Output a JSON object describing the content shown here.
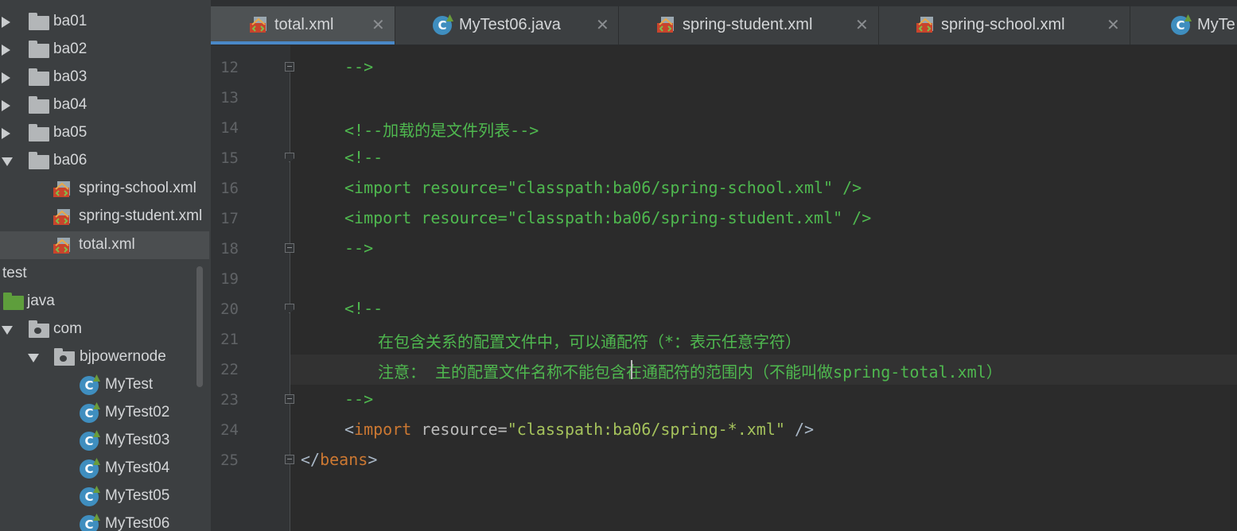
{
  "project_tree": {
    "items": [
      {
        "label": "ba01",
        "type": "folder",
        "expanded": false
      },
      {
        "label": "ba02",
        "type": "folder",
        "expanded": false
      },
      {
        "label": "ba03",
        "type": "folder",
        "expanded": false
      },
      {
        "label": "ba04",
        "type": "folder",
        "expanded": false
      },
      {
        "label": "ba05",
        "type": "folder",
        "expanded": false
      },
      {
        "label": "ba06",
        "type": "folder",
        "expanded": true
      },
      {
        "label": "spring-school.xml",
        "type": "xml-file"
      },
      {
        "label": "spring-student.xml",
        "type": "xml-file"
      },
      {
        "label": "total.xml",
        "type": "xml-file",
        "selected": true
      },
      {
        "label": "test",
        "type": "text"
      },
      {
        "label": "java",
        "type": "source-folder"
      },
      {
        "label": "com",
        "type": "package",
        "expanded": true
      },
      {
        "label": "bjpowernode",
        "type": "package",
        "expanded": true
      },
      {
        "label": "MyTest",
        "type": "class"
      },
      {
        "label": "MyTest02",
        "type": "class"
      },
      {
        "label": "MyTest03",
        "type": "class"
      },
      {
        "label": "MyTest04",
        "type": "class"
      },
      {
        "label": "MyTest05",
        "type": "class"
      },
      {
        "label": "MyTest06",
        "type": "class"
      }
    ]
  },
  "tabs": [
    {
      "label": "total.xml",
      "icon": "xml-file-icon",
      "active": true
    },
    {
      "label": "MyTest06.java",
      "icon": "java-class-icon",
      "active": false
    },
    {
      "label": "spring-student.xml",
      "icon": "xml-file-icon",
      "active": false
    },
    {
      "label": "spring-school.xml",
      "icon": "xml-file-icon",
      "active": false
    },
    {
      "label": "MyTe",
      "icon": "java-class-icon",
      "active": false
    }
  ],
  "editor": {
    "current_line": 22,
    "lines": [
      {
        "num": "12",
        "text": "-->"
      },
      {
        "num": "13",
        "text": ""
      },
      {
        "num": "14",
        "text": "<!--加载的是文件列表-->"
      },
      {
        "num": "15",
        "text": "<!--"
      },
      {
        "num": "16",
        "text": "<import resource=\"classpath:ba06/spring-school.xml\" />"
      },
      {
        "num": "17",
        "text": "<import resource=\"classpath:ba06/spring-student.xml\" />"
      },
      {
        "num": "18",
        "text": "-->"
      },
      {
        "num": "19",
        "text": ""
      },
      {
        "num": "20",
        "text": "<!--"
      },
      {
        "num": "21",
        "text": "在包含关系的配置文件中，可以通配符（*：表示任意字符）"
      },
      {
        "num": "22",
        "text": "注意： 主的配置文件名称不能包含在通配符的范围内（不能叫做spring-total.xml）"
      },
      {
        "num": "23",
        "text": "-->"
      },
      {
        "num": "24",
        "text": "<import resource=\"classpath:ba06/spring-*.xml\" />"
      },
      {
        "num": "25",
        "text": "</beans>"
      }
    ],
    "line24_parts": {
      "open": "<",
      "tag": "import",
      "attr": " resource=",
      "value": "\"classpath:ba06/spring-*.xml\"",
      "close": " />"
    },
    "line25_parts": {
      "open": "</",
      "tag": "beans",
      "close": ">"
    }
  },
  "colors": {
    "comment": "#4fb84f",
    "tag_keyword": "#cc7832",
    "string": "#a5c25c",
    "active_tab_underline": "#4a88c7",
    "tree_background": "#3c3f41",
    "editor_background": "#2b2b2b"
  }
}
